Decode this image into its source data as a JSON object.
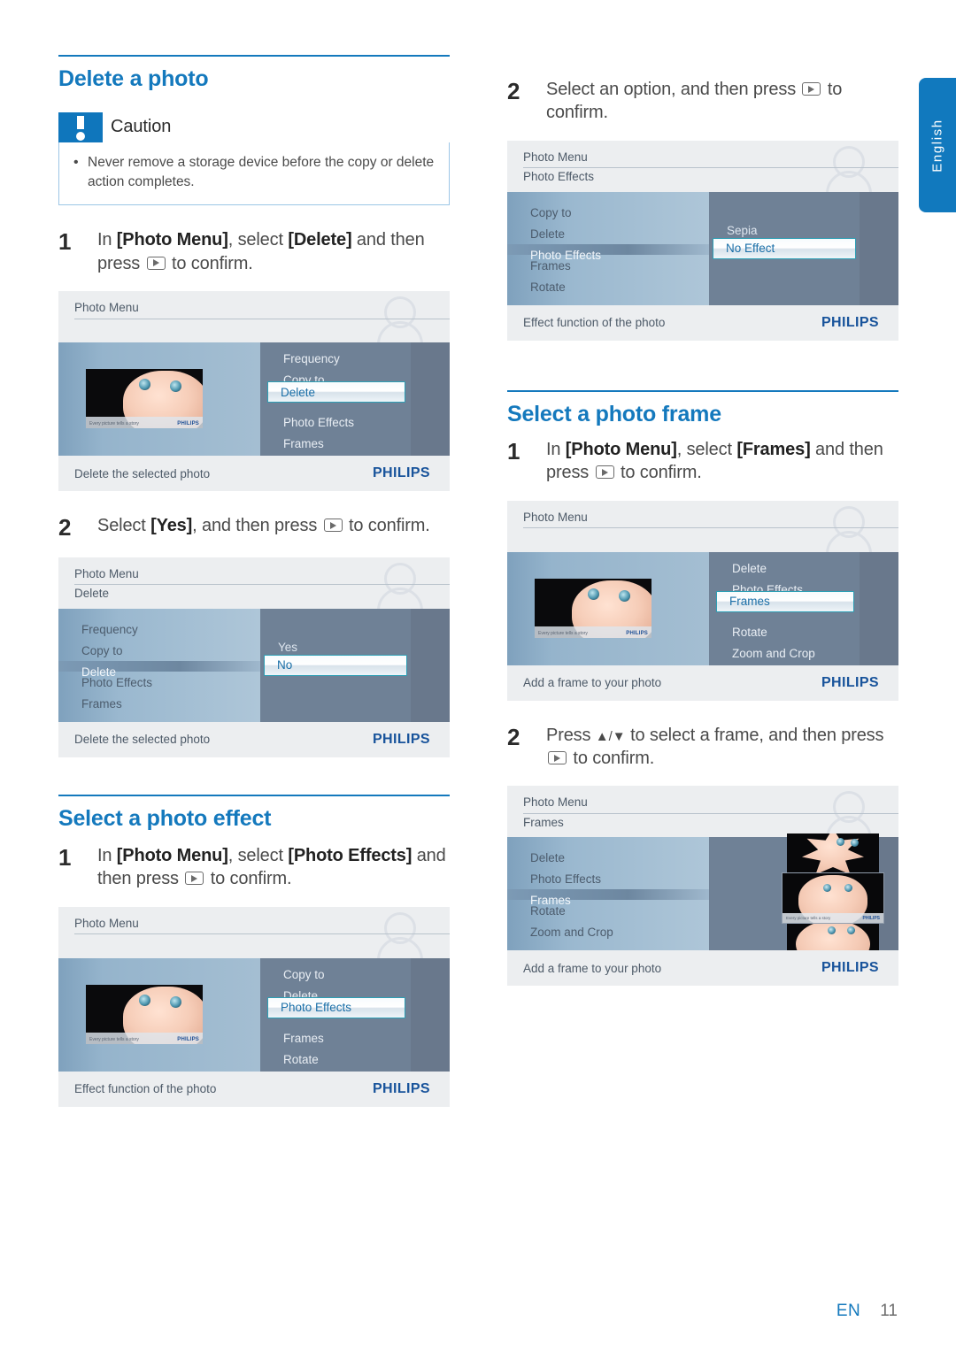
{
  "page": {
    "language_tab": "English",
    "footer_lang": "EN",
    "footer_page": "11",
    "accent_blue": "#1479bd",
    "caution_badge_blue": "#0f76bc"
  },
  "sections": {
    "delete_photo": {
      "heading": "Delete a photo",
      "caution": {
        "title": "Caution",
        "bullet": "Never remove a storage device before the copy or delete action completes."
      },
      "step1": {
        "num": "1",
        "a": "In ",
        "b1": "[Photo Menu]",
        "c": ", select ",
        "b2": "[Delete]",
        "d": " and then press ",
        "e": " to confirm."
      },
      "step2": {
        "num": "2",
        "a": "Select ",
        "b1": "[Yes]",
        "c": ", and then press ",
        "e": " to confirm."
      }
    },
    "photo_effect": {
      "heading": "Select a photo effect",
      "step1": {
        "num": "1",
        "a": "In ",
        "b1": "[Photo Menu]",
        "c": ", select ",
        "b2": "[Photo Effects]",
        "d": " and then press ",
        "e": " to confirm."
      },
      "step2": {
        "num": "2",
        "a": "Select an option, and then press ",
        "e": " to confirm."
      }
    },
    "photo_frame": {
      "heading": "Select a photo frame",
      "step1": {
        "num": "1",
        "a": "In ",
        "b1": "[Photo Menu]",
        "c": ", select ",
        "b2": "[Frames]",
        "d": " and then press ",
        "e": " to confirm."
      },
      "step2": {
        "num": "2",
        "a": "Press ",
        "arrows": "▲/▼",
        "c": " to select a frame, and then press ",
        "e": " to confirm."
      }
    }
  },
  "screens": {
    "delete_menu": {
      "title": "Photo Menu",
      "subtitle": "",
      "items": [
        "Frequency",
        "Copy to",
        "Delete",
        "Photo Effects",
        "Frames"
      ],
      "selected": "Delete",
      "hint": "Delete the selected photo",
      "brand": "PHILIPS",
      "photo_caption": "Every picture tells a story",
      "photo_brand": "PHILIPS"
    },
    "delete_confirm": {
      "title": "Photo Menu",
      "subtitle": "Delete",
      "items": [
        "Frequency",
        "Copy to",
        "Delete",
        "Photo Effects",
        "Frames"
      ],
      "highlighted": "Delete",
      "options": [
        "Yes",
        "No"
      ],
      "selected_option": "No",
      "hint": "Delete the selected photo",
      "brand": "PHILIPS"
    },
    "effects_menu": {
      "title": "Photo Menu",
      "subtitle": "",
      "items": [
        "Copy to",
        "Delete",
        "Photo Effects",
        "Frames",
        "Rotate"
      ],
      "selected": "Photo Effects",
      "hint": "Effect function of the photo",
      "brand": "PHILIPS",
      "photo_caption": "Every picture tells a story",
      "photo_brand": "PHILIPS"
    },
    "effects_options": {
      "title": "Photo Menu",
      "subtitle": "Photo Effects",
      "items": [
        "Copy to",
        "Delete",
        "Photo Effects",
        "Frames",
        "Rotate"
      ],
      "highlighted": "Photo Effects",
      "options": [
        "Sepia",
        "No Effect"
      ],
      "selected_option": "No Effect",
      "hint": "Effect function of the photo",
      "brand": "PHILIPS"
    },
    "frames_menu": {
      "title": "Photo Menu",
      "subtitle": "",
      "items": [
        "Delete",
        "Photo Effects",
        "Frames",
        "Rotate",
        "Zoom and Crop"
      ],
      "selected": "Frames",
      "hint": "Add a frame to your photo",
      "brand": "PHILIPS",
      "photo_caption": "Every picture tells a story",
      "photo_brand": "PHILIPS"
    },
    "frames_options": {
      "title": "Photo Menu",
      "subtitle": "Frames",
      "items": [
        "Delete",
        "Photo Effects",
        "Frames",
        "Rotate",
        "Zoom and Crop"
      ],
      "highlighted": "Frames",
      "hint": "Add a frame to your photo",
      "brand": "PHILIPS",
      "thumb_caption": "Every picture tells a story",
      "thumb_brand": "PHILIPS"
    }
  }
}
